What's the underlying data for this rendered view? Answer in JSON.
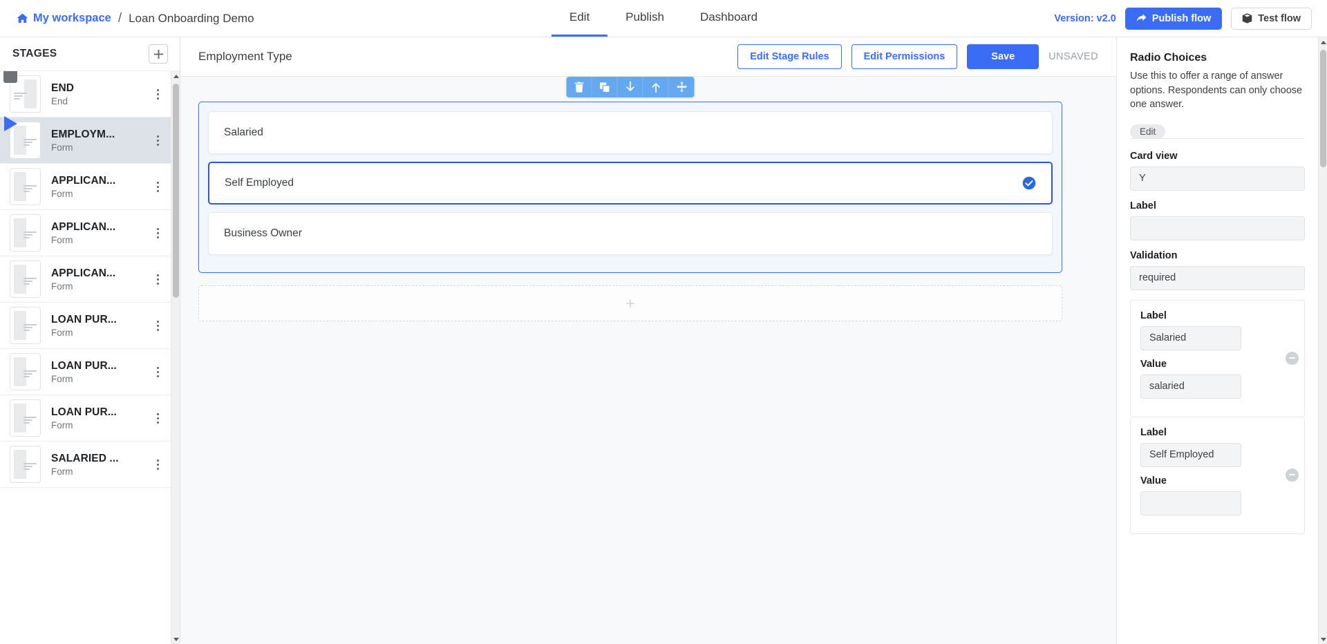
{
  "topbar": {
    "home_label": "My workspace",
    "separator": "/",
    "project_title": "Loan Onboarding Demo",
    "tabs": [
      {
        "label": "Edit",
        "active": true
      },
      {
        "label": "Publish",
        "active": false
      },
      {
        "label": "Dashboard",
        "active": false
      }
    ],
    "version_text": "Version: v2.0",
    "publish_label": "Publish flow",
    "test_label": "Test flow",
    "accent_color": "#3b6cf6"
  },
  "sidebar": {
    "title": "STAGES",
    "add_label": "+",
    "stages": [
      {
        "name": "END",
        "type": "End",
        "icon": "end-badge",
        "selected": false
      },
      {
        "name": "EMPLOYM...",
        "type": "Form",
        "icon": "play-badge",
        "selected": true
      },
      {
        "name": "APPLICAN...",
        "type": "Form",
        "icon": "none",
        "selected": false
      },
      {
        "name": "APPLICAN...",
        "type": "Form",
        "icon": "none",
        "selected": false
      },
      {
        "name": "APPLICAN...",
        "type": "Form",
        "icon": "none",
        "selected": false
      },
      {
        "name": "LOAN PUR...",
        "type": "Form",
        "icon": "none",
        "selected": false
      },
      {
        "name": "LOAN PUR...",
        "type": "Form",
        "icon": "none",
        "selected": false
      },
      {
        "name": "LOAN PUR...",
        "type": "Form",
        "icon": "none",
        "selected": false
      },
      {
        "name": "SALARIED ...",
        "type": "Form",
        "icon": "none",
        "selected": false
      }
    ]
  },
  "center": {
    "stage_heading": "Employment Type",
    "edit_stage_rules_label": "Edit Stage Rules",
    "edit_permissions_label": "Edit Permissions",
    "save_label": "Save",
    "unsaved_label": "UNSAVED",
    "toolbar_icons": [
      "trash-icon",
      "duplicate-icon",
      "move-down-icon",
      "move-up-icon",
      "drag-move-icon"
    ],
    "options": [
      {
        "label": "Salaried",
        "selected": false
      },
      {
        "label": "Self Employed",
        "selected": true
      },
      {
        "label": "Business Owner",
        "selected": false
      }
    ],
    "add_element_label": "+"
  },
  "rightpanel": {
    "title": "Radio Choices",
    "description": "Use this to offer a range of answer options. Respondents can only choose one answer.",
    "tab_label": "Edit",
    "fields": [
      {
        "label": "Card view",
        "value": "Y"
      },
      {
        "label": "Label",
        "value": ""
      },
      {
        "label": "Validation",
        "value": "required"
      }
    ],
    "choice_cards": [
      {
        "label_title": "Label",
        "label_value": "Salaried",
        "value_title": "Value",
        "value_value": "salaried"
      },
      {
        "label_title": "Label",
        "label_value": "Self Employed",
        "value_title": "Value",
        "value_value": ""
      }
    ]
  }
}
